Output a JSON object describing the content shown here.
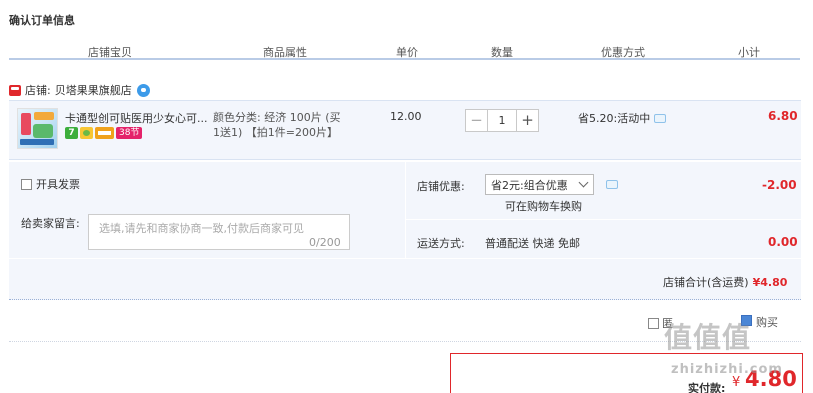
{
  "page_title": "确认订单信息",
  "columns": [
    "店铺宝贝",
    "商品属性",
    "单价",
    "数量",
    "优惠方式",
    "小计"
  ],
  "shop": {
    "label": "店铺:",
    "name": "贝塔果果旗舰店"
  },
  "item": {
    "title": "卡通型创可贴医用少女心可...",
    "badges": [
      "7",
      "38节"
    ],
    "attr_line1": "颜色分类: 经济 100片 (买",
    "attr_line2": "1送1) 【拍1件=200片】",
    "unit_price": "12.00",
    "quantity": "1",
    "minus": "−",
    "plus": "+",
    "discount": "省5.20:活动中",
    "subtotal": "6.80"
  },
  "options": {
    "invoice_label": "开具发票",
    "message_label": "给卖家留言:",
    "message_placeholder": "选填,请先和商家协商一致,付款后商家可见",
    "message_count": "0/200",
    "shop_discount_label": "店铺优惠:",
    "shop_discount_selected": "省2元:组合优惠",
    "exchange_text": "可在购物车换购",
    "shop_discount_value": "-2.00",
    "shipping_label": "运送方式:",
    "shipping_value": "普通配送 快递 免邮",
    "shipping_price": "0.00",
    "shop_total_label": "店铺合计(含运费)",
    "shop_total_value": "¥4.80"
  },
  "footer": {
    "anon_partial_1": "匿",
    "anon_partial_2": "购买",
    "pay_label": "实付款:",
    "pay_currency": "¥",
    "pay_amount": "4.80"
  },
  "watermark": {
    "text": "值值值",
    "url": "zhizhizhi.com"
  }
}
